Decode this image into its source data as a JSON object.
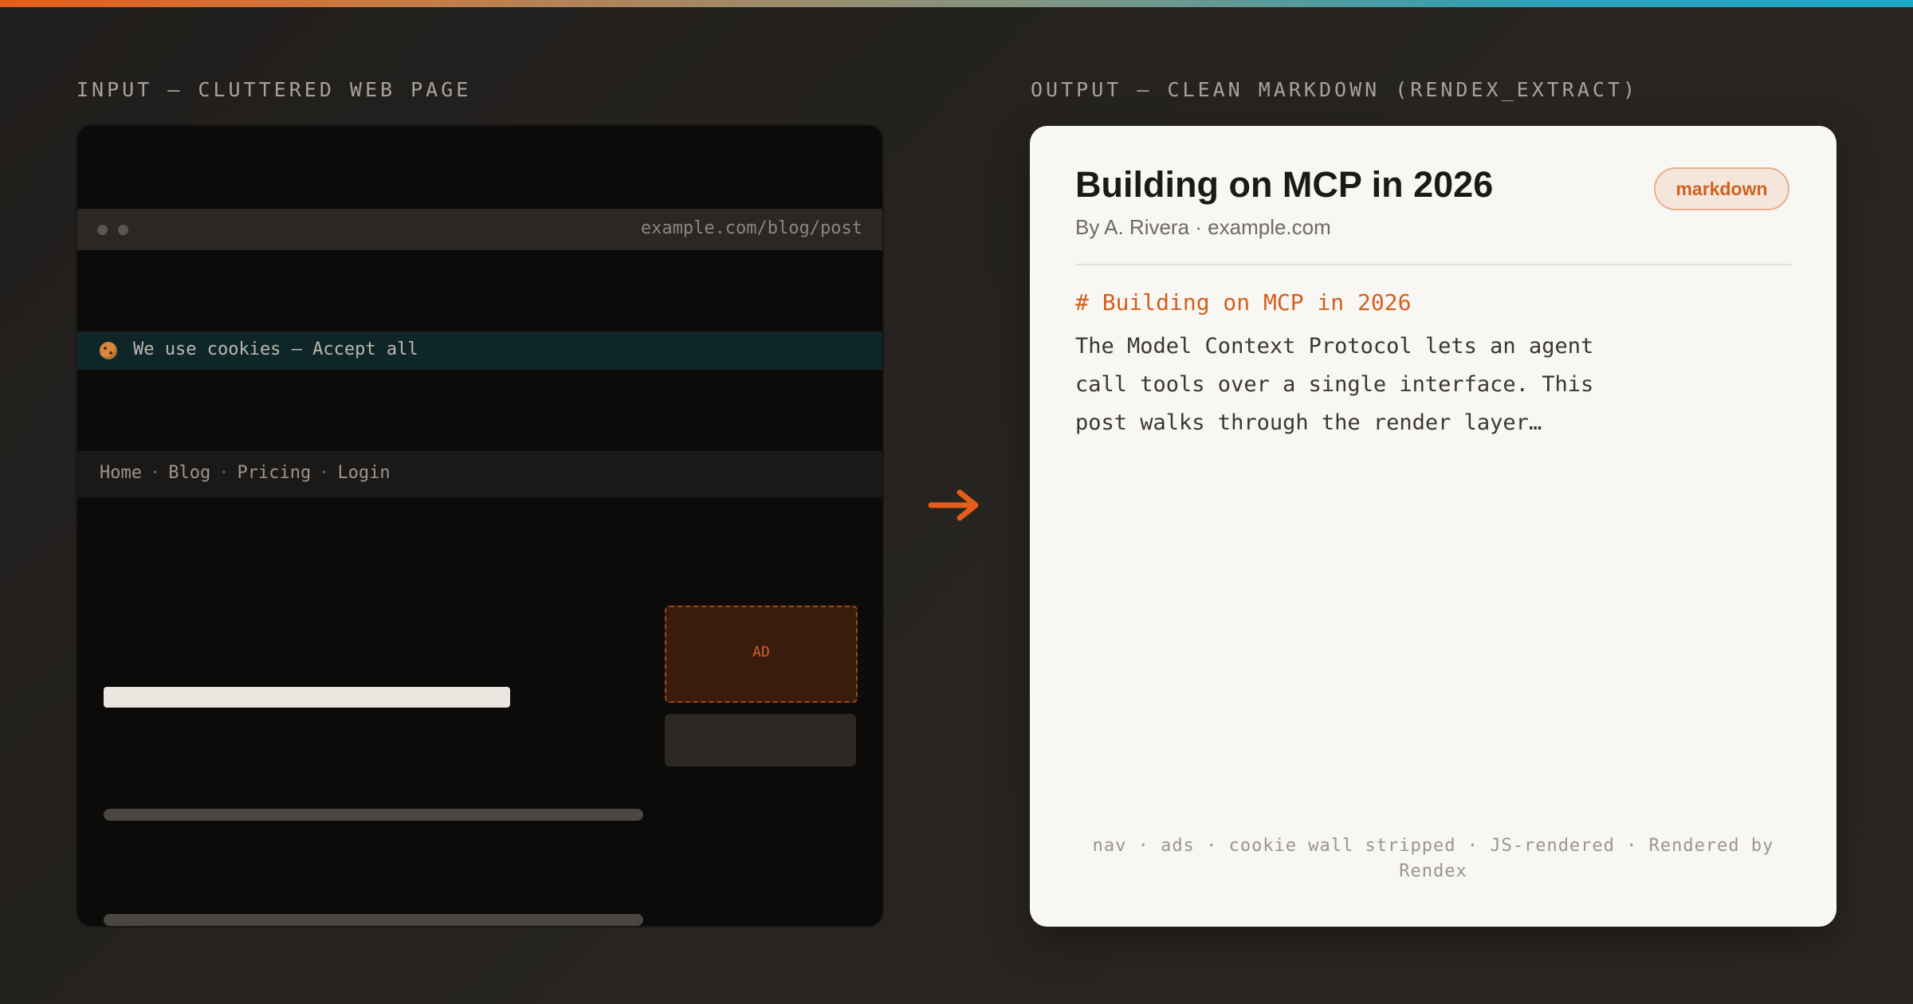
{
  "colors": {
    "accent": "#e65c1a",
    "teal": "#1ea9c9",
    "background": "#24211f",
    "card": "#f8f7f4"
  },
  "input_section": {
    "label": "INPUT — CLUTTERED WEB PAGE",
    "browser": {
      "url": "example.com/blog/post",
      "cookie_text": "We use cookies — Accept all",
      "cookie_icon": "cookie-icon",
      "nav_items": [
        "Home",
        "Blog",
        "Pricing",
        "Login"
      ],
      "nav_separator": "·",
      "ad_label": "AD"
    }
  },
  "arrow_icon": "arrow-right-icon",
  "output_section": {
    "label": "OUTPUT — CLEAN MARKDOWN (RENDEX_EXTRACT)",
    "card": {
      "title": "Building on MCP in 2026",
      "byline": "By A. Rivera · example.com",
      "badge": "markdown",
      "md_heading": "# Building on MCP in 2026",
      "md_body": "The Model Context Protocol lets an agent call tools over a single interface. This post walks through the render layer…",
      "footer": "nav · ads · cookie wall stripped · JS-rendered · Rendered by Rendex"
    }
  }
}
